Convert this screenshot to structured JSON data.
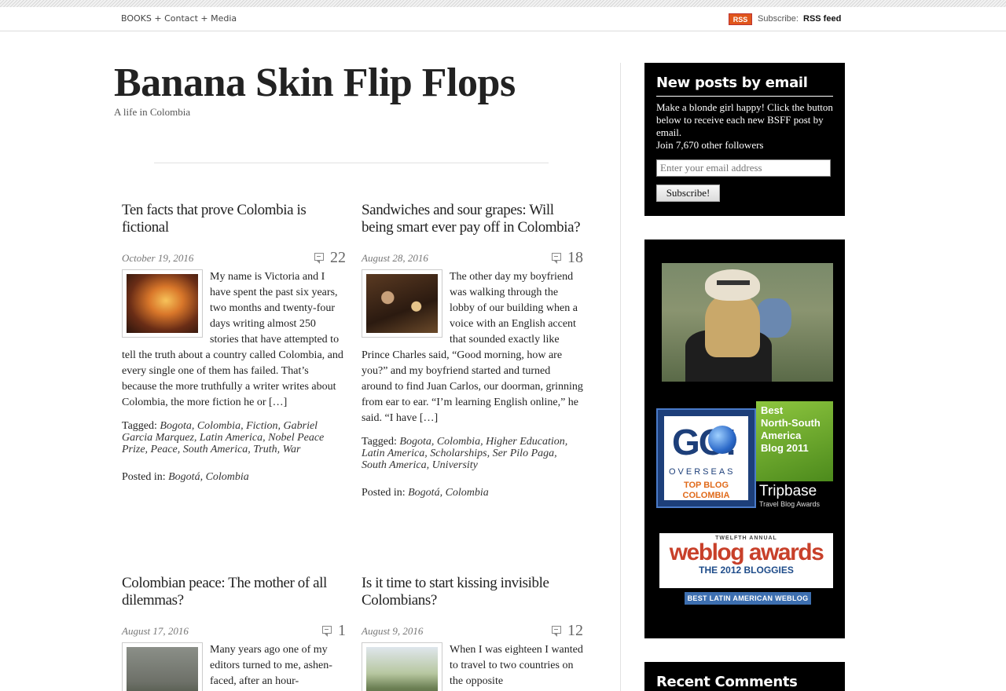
{
  "topbar": {
    "nav": [
      "BOOKS",
      "Contact",
      "Media"
    ],
    "nav_sep": " + ",
    "rss_badge": "RSS",
    "subscribe_label": "Subscribe:",
    "rss_feed": "RSS feed"
  },
  "site": {
    "title": "Banana Skin Flip Flops",
    "tagline": "A life in Colombia"
  },
  "posts": [
    {
      "title": "Ten facts that prove Colombia is fictional",
      "date": "October 19, 2016",
      "comments": "22",
      "excerpt": "My name is Victoria and I have spent the past six years, two months and twenty-four days writing almost 250 stories that have attempted to tell the truth about a country called Colombia, and every single one of them has failed. That’s because the more truthfully a writer writes about Colombia, the more fiction he or […]",
      "tagged_label": "Tagged:",
      "tags": "Bogota, Colombia, Fiction, Gabriel Garcia Marquez, Latin America, Nobel Peace Prize, Peace, South America, Truth, War",
      "posted_label": "Posted in:",
      "posted_in": "Bogotá, Colombia"
    },
    {
      "title": "Sandwiches and sour grapes: Will being smart ever pay off in Colombia?",
      "date": "August 28, 2016",
      "comments": "18",
      "excerpt": "The other day my boyfriend was walking through the lobby of our building when a voice with an English accent that sounded exactly like Prince Charles said, “Good morning, how are you?” and my boyfriend started and turned around to find Juan Carlos, our doorman, grinning from ear to ear. “I’m learning English online,” he said. “I have […]",
      "tagged_label": "Tagged:",
      "tags": "Bogota, Colombia, Higher Education, Latin America, Scholarships, Ser Pilo Paga, South America, University",
      "posted_label": "Posted in:",
      "posted_in": "Bogotá, Colombia"
    },
    {
      "title": "Colombian peace: The mother of all dilemmas?",
      "date": "August 17, 2016",
      "comments": "1",
      "excerpt": "Many years ago one of my editors turned to me, ashen-faced, after an hour-"
    },
    {
      "title": "Is it time to start kissing invisible Colombians?",
      "date": "August 9, 2016",
      "comments": "12",
      "excerpt": "When I was eighteen I wanted to travel to two countries on the opposite"
    }
  ],
  "sidebar": {
    "email_widget": {
      "title": "New posts by email",
      "text": "Make a blonde girl happy! Click the button below to receive each new BSFF post by email.",
      "followers": "Join 7,670 other followers",
      "placeholder": "Enter your email address",
      "button": "Subscribe!"
    },
    "badges": {
      "go_word": "GO!",
      "go_sub": "OVERSEAS",
      "go_top_blog": "TOP BLOG",
      "go_country": "COLOMBIA",
      "tripbase_award": [
        "Best",
        "North-South",
        "America",
        "Blog 2011"
      ],
      "tripbase_name": "Tripbase",
      "tripbase_sub": "Travel Blog Awards",
      "weblog_twelfth": "TWELFTH ANNUAL",
      "weblog_main": "weblog awards",
      "weblog_year": "THE 2012 BLOGGIES",
      "weblog_bar": "BEST LATIN AMERICAN WEBLOG"
    },
    "recent_comments_title": "Recent Comments"
  },
  "colors": {
    "sidebar_bg": "#000000",
    "rss_orange": "#e0561b",
    "text": "#222222"
  }
}
